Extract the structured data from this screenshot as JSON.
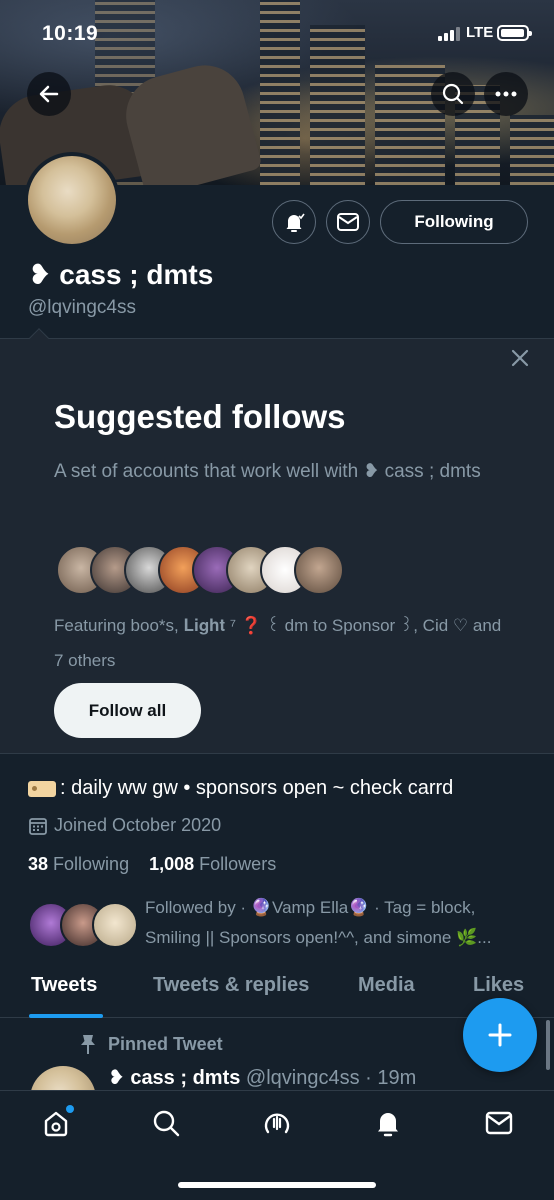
{
  "status_bar": {
    "time": "10:19",
    "network": "LTE"
  },
  "profile": {
    "display_name": "❥ cass ; dmts",
    "handle": "@lqvingc4ss",
    "following_label": "Following"
  },
  "suggested": {
    "title": "Suggested follows",
    "description": "A set of accounts that work well with ❥ cass ; dmts",
    "featuring": "Featuring boo*s, 𝐋𝐢𝐠𝐡𝐭 ⁷ ❓ ꒰ dm to Sponsor ꒱, Cid ♡ and 7 others",
    "follow_all_label": "Follow all"
  },
  "bio": {
    "text": ": daily ww gw • sponsors open ~ check carrd",
    "joined": "Joined October 2020",
    "following_count": "38",
    "following_label": "Following",
    "followers_count": "1,008",
    "followers_label": "Followers",
    "followed_by": "Followed by · 🔮Vamp Ella🔮 · Tag = block, Smiling || Sponsors open!^^, and simone 🌿..."
  },
  "tabs": [
    "Tweets",
    "Tweets & replies",
    "Media",
    "Likes"
  ],
  "pinned": {
    "label": "Pinned Tweet",
    "name": "❥ cass ; dmts",
    "meta": " @lqvingc4ss · 19m"
  },
  "colors": {
    "accent": "#1d9bf0",
    "background": "#15202b",
    "panel": "#1e2732",
    "muted": "#8899a6"
  },
  "icons": [
    "back-arrow-icon",
    "search-icon",
    "more-icon",
    "bell-icon",
    "mail-icon",
    "close-icon",
    "calendar-icon",
    "pin-icon",
    "compose-plus-icon",
    "home-icon",
    "spaces-icon",
    "notifications-icon",
    "messages-icon"
  ]
}
